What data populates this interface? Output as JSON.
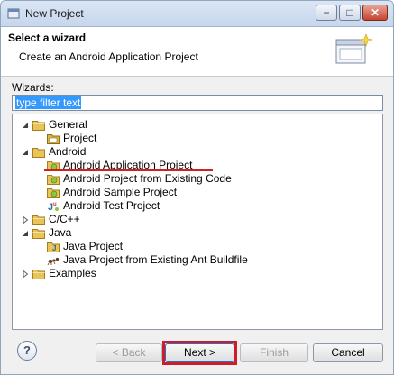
{
  "window": {
    "title": "New Project",
    "controls": {
      "minimize": "−",
      "maximize": "□",
      "close": "✕"
    }
  },
  "header": {
    "title": "Select a wizard",
    "description": "Create an Android Application Project"
  },
  "wizards": {
    "label": "Wizards:",
    "filter_value": "type filter text"
  },
  "tree": {
    "items": [
      {
        "label": "General",
        "icon": "folder-icon",
        "expanded": true
      },
      {
        "label": "Project",
        "icon": "project-icon"
      },
      {
        "label": "Android",
        "icon": "folder-icon",
        "expanded": true
      },
      {
        "label": "Android Application Project",
        "icon": "android-app-project-icon",
        "marked": true
      },
      {
        "label": "Android Project from Existing Code",
        "icon": "android-project-icon"
      },
      {
        "label": "Android Sample Project",
        "icon": "android-project-icon"
      },
      {
        "label": "Android Test Project",
        "icon": "android-test-icon"
      },
      {
        "label": "C/C++",
        "icon": "folder-icon",
        "expanded": false
      },
      {
        "label": "Java",
        "icon": "folder-icon",
        "expanded": true
      },
      {
        "label": "Java Project",
        "icon": "java-project-icon"
      },
      {
        "label": "Java Project from Existing Ant Buildfile",
        "icon": "ant-buildfile-icon"
      },
      {
        "label": "Examples",
        "icon": "folder-icon",
        "expanded": false
      }
    ]
  },
  "buttons": {
    "help": "?",
    "back": "< Back",
    "next": "Next >",
    "finish": "Finish",
    "cancel": "Cancel"
  },
  "colors": {
    "accent_highlight": "#cc1d2a",
    "selection": "#3399ff",
    "folder": "#e8c45a"
  }
}
